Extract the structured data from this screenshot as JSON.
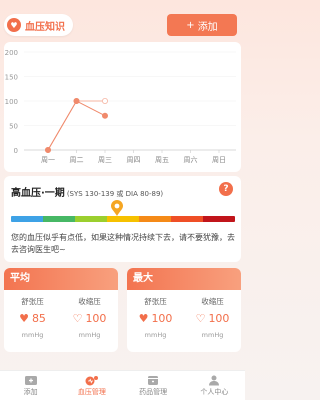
{
  "header": {
    "title": "血压知识",
    "add_label": "添加"
  },
  "chart_data": {
    "type": "line",
    "categories": [
      "周一",
      "周二",
      "周三",
      "周四",
      "周五",
      "周六",
      "周日"
    ],
    "series": [
      {
        "values": [
          0,
          100,
          100,
          null,
          null,
          null,
          null
        ],
        "color": "#f5b4a2"
      },
      {
        "values": [
          0,
          100,
          70,
          null,
          null,
          null,
          null
        ],
        "color": "#f08a6c"
      }
    ],
    "yticks": [
      "200",
      "150",
      "100",
      "50",
      "0"
    ],
    "ylim": [
      0,
      200
    ]
  },
  "bp_info": {
    "title": "高血压·一期",
    "range": "(SYS 130-139 或 DIA 80-89)",
    "help": "?",
    "scale_colors": [
      "#3ea2e6",
      "#47b865",
      "#9bcf2e",
      "#f6c100",
      "#f58a18",
      "#ef4f26",
      "#c1151b"
    ],
    "marker_color": "#f5a623",
    "description": "您的血压似乎有点低，如果这种情况持续下去，请不要犹豫，去去咨询医生吧~"
  },
  "stats": {
    "avg": {
      "title": "平均",
      "systolic_label": "舒张压",
      "systolic_value": "85",
      "diastolic_label": "收缩压",
      "diastolic_value": "100",
      "unit": "mmHg"
    },
    "max": {
      "title": "最大",
      "systolic_label": "舒张压",
      "systolic_value": "100",
      "diastolic_label": "收缩压",
      "diastolic_value": "100",
      "unit": "mmHg"
    }
  },
  "nav": {
    "items": [
      {
        "label": "添加",
        "icon": "add-record-icon"
      },
      {
        "label": "血压管理",
        "icon": "blood-pressure-icon"
      },
      {
        "label": "药品管理",
        "icon": "medicine-icon"
      },
      {
        "label": "个人中心",
        "icon": "person-icon"
      }
    ]
  }
}
